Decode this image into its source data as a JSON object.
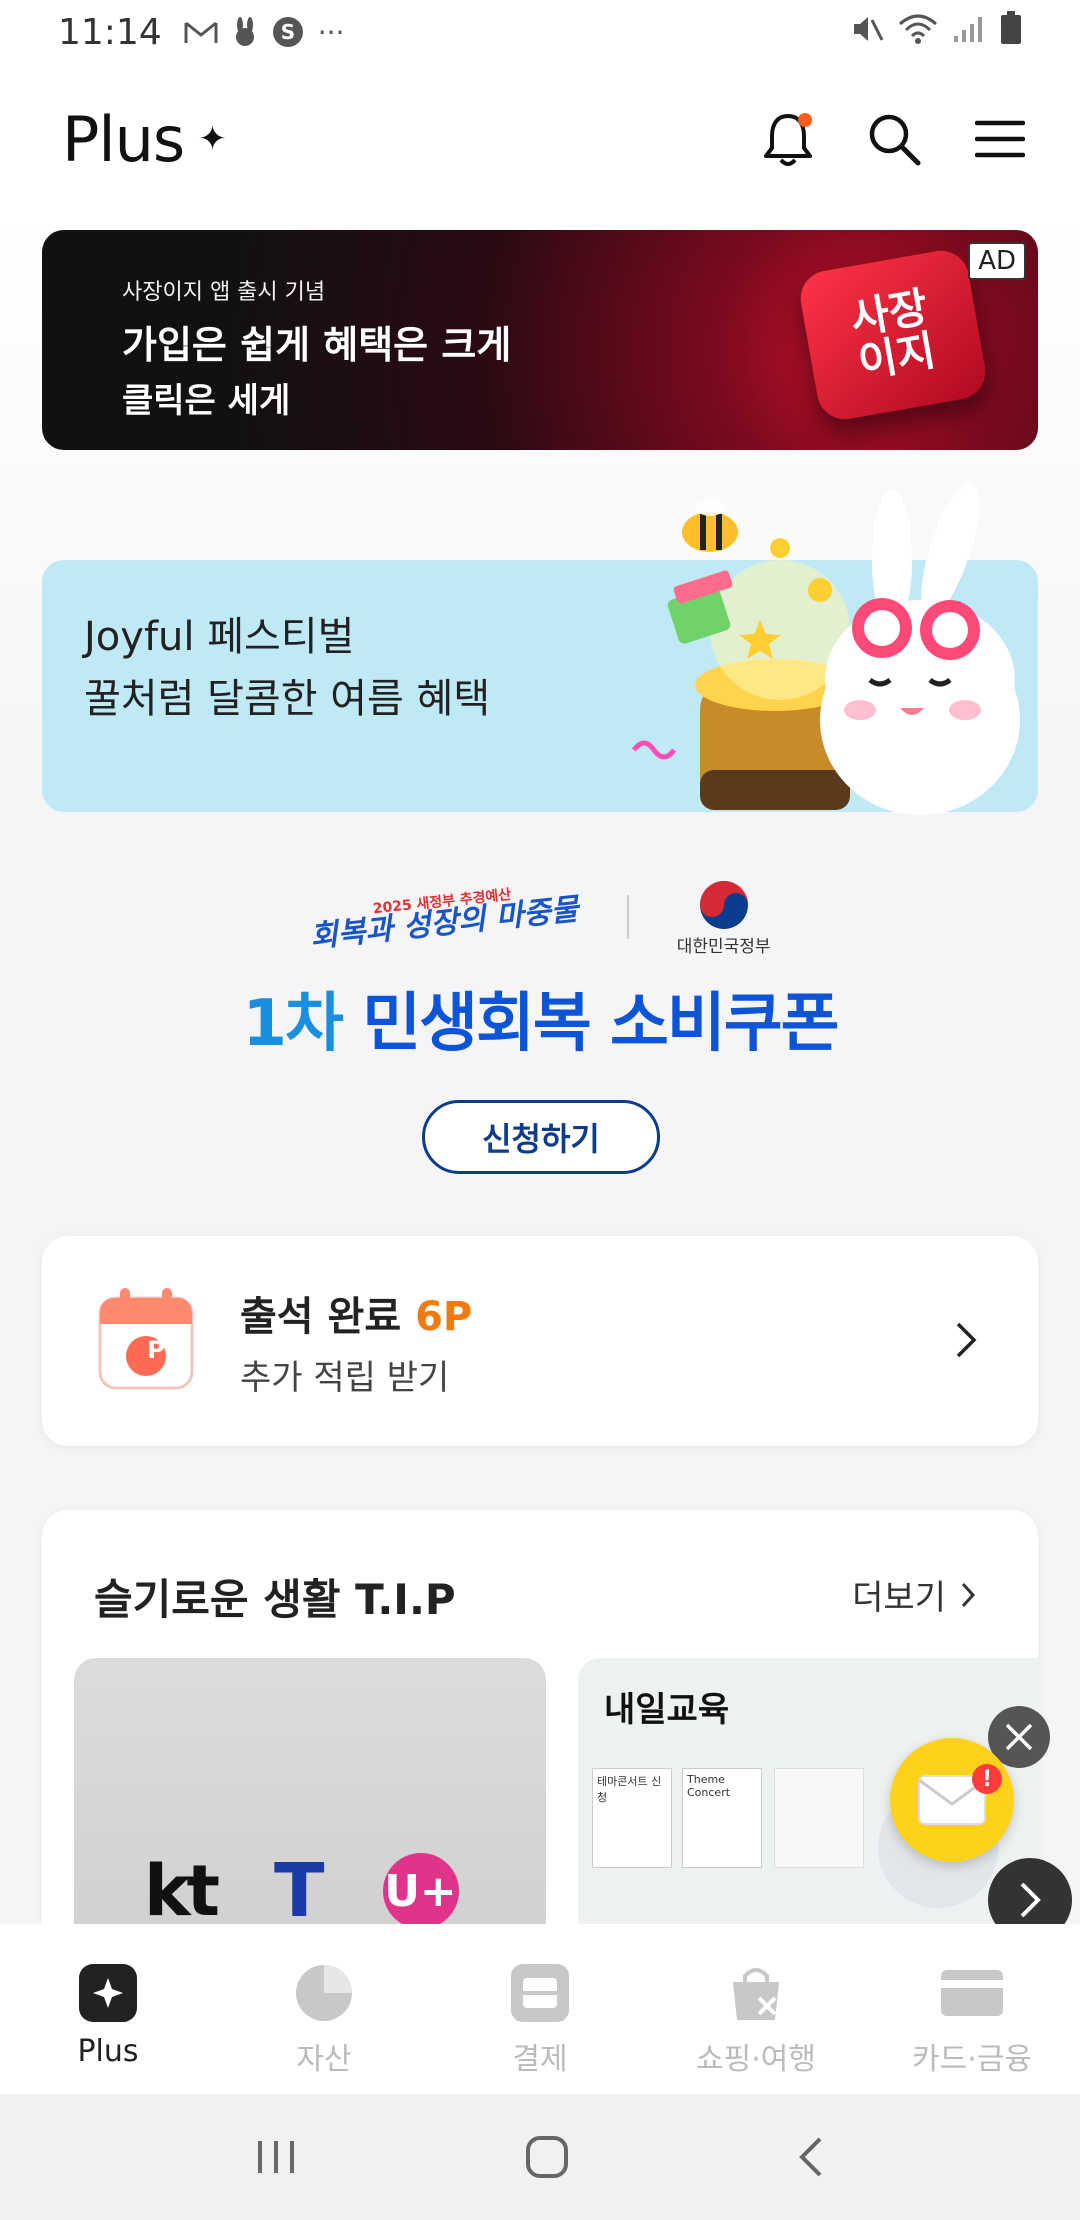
{
  "status_bar": {
    "time": "11:14",
    "more": "···"
  },
  "header": {
    "brand": "Plus",
    "brand_mark": "✦"
  },
  "ad_banner": {
    "kicker": "사장이지 앱 출시 기념",
    "headline": "가입은 쉽게 혜택은 크게",
    "subline": "클릭은 세게",
    "key_line1": "사장",
    "key_line2": "이지",
    "ad_label": "AD"
  },
  "promo": {
    "line1": "Joyful 페스티벌",
    "line2": "꿀처럼 달콤한 여름 혜택"
  },
  "coupon": {
    "event_year": "2025 새정부 추경예산",
    "event_logo": "회복과 성장의 마중물",
    "gov_name": "대한민국정부",
    "title_num": "1차",
    "title_rest": " 민생회복 소비쿠폰",
    "apply_label": "신청하기"
  },
  "attendance": {
    "calendar_letter": "P",
    "title": "출석 완료",
    "points": "6P",
    "subtitle": "추가 적립 받기"
  },
  "tips": {
    "title": "슬기로운 생활 T.I.P",
    "more_label": "더보기",
    "tile1_logos": [
      "kt",
      "T",
      "U+"
    ],
    "tile2_title": "내일교육",
    "tile2_cards": [
      "테마콘서트 신청",
      "Theme Concert"
    ]
  },
  "fab": {
    "badge": "!"
  },
  "bottom_nav": {
    "items": [
      {
        "label": "Plus",
        "icon": "plus-sparkle-icon",
        "active": true
      },
      {
        "label": "자산",
        "icon": "pie-chart-icon",
        "active": false
      },
      {
        "label": "결제",
        "icon": "scan-icon",
        "active": false
      },
      {
        "label": "쇼핑·여행",
        "icon": "shopping-bag-icon",
        "active": false
      },
      {
        "label": "카드·금융",
        "icon": "card-icon",
        "active": false
      }
    ]
  },
  "colors": {
    "accent_orange": "#f07a0c",
    "coupon_blue": "#0d55d6",
    "promo_bg": "#bfe9f5",
    "notification_dot": "#ff5a1f"
  }
}
